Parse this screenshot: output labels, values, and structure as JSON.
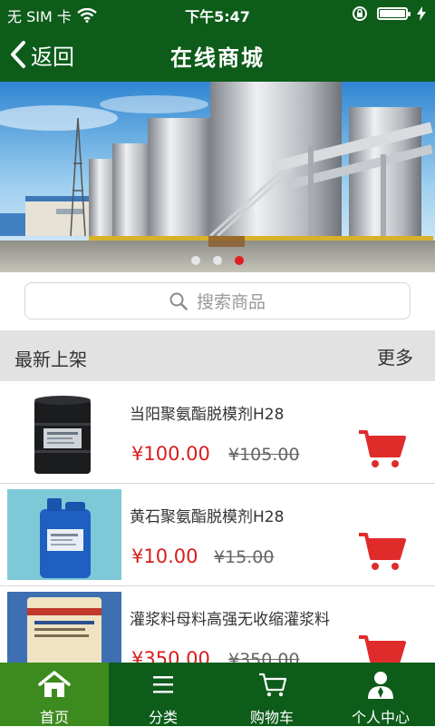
{
  "status_bar": {
    "carrier": "无 SIM 卡",
    "time": "下午5:47",
    "battery_level": 1.0
  },
  "nav": {
    "back_label": "返回",
    "title": "在线商城"
  },
  "banner": {
    "slide_count": 3,
    "active_index": 2
  },
  "search": {
    "placeholder": "搜索商品"
  },
  "section": {
    "title": "最新上架",
    "more_label": "更多"
  },
  "products": [
    {
      "name": "当阳聚氨酯脱模剂H28",
      "price": "¥100.00",
      "original_price": "¥105.00"
    },
    {
      "name": "黄石聚氨酯脱模剂H28",
      "price": "¥10.00",
      "original_price": "¥15.00"
    },
    {
      "name": "灌浆料母料高强无收缩灌浆料",
      "price": "¥350.00",
      "original_price": "¥350.00"
    }
  ],
  "tabs": [
    {
      "label": "首页",
      "icon": "home-icon",
      "active": true
    },
    {
      "label": "分类",
      "icon": "menu-icon",
      "active": false
    },
    {
      "label": "购物车",
      "icon": "cart-icon",
      "active": false
    },
    {
      "label": "个人中心",
      "icon": "user-icon",
      "active": false
    }
  ],
  "colors": {
    "brand_green": "#0d5c1a",
    "active_tab": "#3d8a1f",
    "price_red": "#d81e1e",
    "cart_red": "#e02b2b"
  }
}
